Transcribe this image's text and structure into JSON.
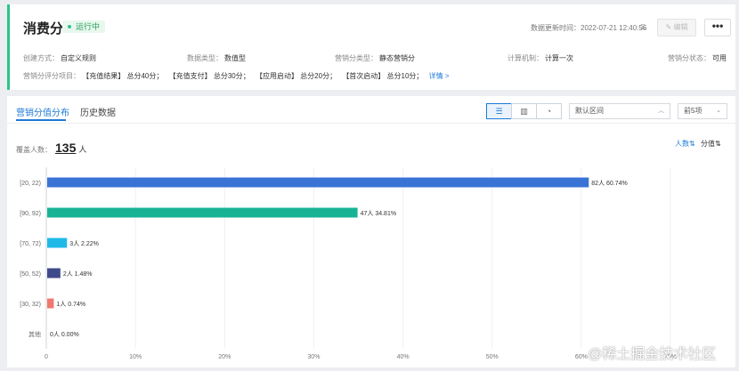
{
  "header": {
    "title": "消费分",
    "status": "运行中",
    "updated_label": "数据更新时间：",
    "updated_value": "2022-07-21 12:40:56",
    "edit_label": "编辑",
    "more_label": "•••"
  },
  "meta": {
    "create_label": "创建方式：",
    "create_value": "自定义规则",
    "dtype_label": "数据类型：",
    "dtype_value": "数值型",
    "mtype_label": "营销分类型：",
    "mtype_value": "静态营销分",
    "calc_label": "计算机制：",
    "calc_value": "计算一次",
    "state_label": "营销分状态：",
    "state_value": "可用"
  },
  "rules": {
    "label": "营销分评分项目：",
    "items": [
      "【充值结果】 总分40分；",
      "【充值支付】 总分30分；",
      "【应用启动】 总分20分；",
      "【首次启动】 总分10分；"
    ],
    "detail": "详情 >"
  },
  "tabs": [
    "营销分值分布",
    "历史数据"
  ],
  "controls": {
    "range_select": "默认区间",
    "top_select": "前5项"
  },
  "cover": {
    "label": "覆盖人数：",
    "value": "135",
    "unit": "人"
  },
  "sort": {
    "by_count": "人数⇅",
    "by_score": "分值⇅"
  },
  "colors": {
    "accent": "#2ec48b",
    "link": "#1e7ad6"
  },
  "chart_data": {
    "type": "bar",
    "orientation": "horizontal",
    "categories": [
      "[20, 22)",
      "[90, 92)",
      "[70, 72)",
      "[50, 52)",
      "[30, 32)",
      "其他"
    ],
    "values": [
      60.74,
      34.81,
      2.22,
      1.48,
      0.74,
      0.0
    ],
    "data_labels": [
      "82人 60.74%",
      "47人 34.81%",
      "3人 2.22%",
      "2人 1.48%",
      "1人 0.74%",
      "0人 0.00%"
    ],
    "colors": [
      "#3a73d6",
      "#17b394",
      "#1fb9e8",
      "#3f4a8a",
      "#f0786e",
      "#999999"
    ],
    "x_ticks": [
      "0",
      "10%",
      "20%",
      "30%",
      "40%",
      "50%",
      "60%",
      "70%"
    ],
    "x_tick_values": [
      0,
      10,
      20,
      30,
      40,
      50,
      60,
      70
    ],
    "xlim": [
      0,
      70
    ],
    "grid": true
  }
}
